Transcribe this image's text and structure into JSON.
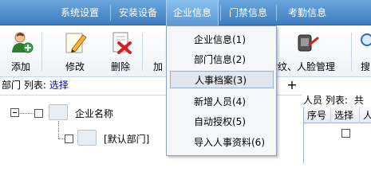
{
  "menubar": {
    "items": [
      "系统设置",
      "安装设备",
      "企业信息",
      "门禁信息",
      "考勤信息"
    ]
  },
  "toolbar": {
    "buttons": [
      {
        "label": "添加",
        "icon": "add-user-icon"
      },
      {
        "label": "修改",
        "icon": "edit-pencil-icon"
      },
      {
        "label": "删除",
        "icon": "delete-doc-icon"
      },
      {
        "label": "加"
      },
      {
        "label": "指纹、人脸管理",
        "icon": "fingerprint-face-icon"
      },
      {
        "label": "搜",
        "icon": "search-icon"
      }
    ]
  },
  "dropdown": {
    "items": [
      "企业信息(1)",
      "部门信息(2)",
      "人事档案(3)",
      "新增人员(4)",
      "自动授权(5)",
      "导入人事资料(6)"
    ],
    "hovered_index": 2
  },
  "left_panel": {
    "label": "部门 列表:",
    "select_link": "选择",
    "plus": "+",
    "tree": {
      "root": "企业名称",
      "child": "[默认部门]"
    }
  },
  "right_panel": {
    "label": "人员 列表:",
    "label_cut": "共",
    "columns": [
      "序号",
      "选择",
      "人"
    ]
  }
}
